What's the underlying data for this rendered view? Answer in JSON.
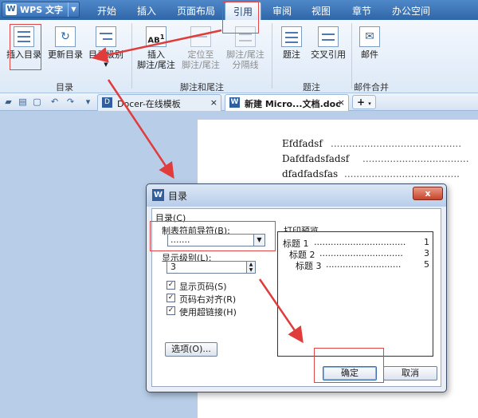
{
  "app": {
    "name": "WPS 文字",
    "logo_letter": "W"
  },
  "menu": [
    "开始",
    "插入",
    "页面布局",
    "引用",
    "审阅",
    "视图",
    "章节",
    "办公空间"
  ],
  "menu_active": "引用",
  "ribbon": {
    "insert_toc": "插入目录",
    "update_toc": "更新目录",
    "toc_level": "目录级别",
    "toc_group": "目录",
    "insert_footnote_1": "插入",
    "insert_footnote_2": "脚注/尾注",
    "goto_footnote_1": "定位至",
    "goto_footnote_2": "脚注/尾注",
    "footnote_sep_1": "脚注/尾注",
    "footnote_sep_2": "分隔线",
    "footnote_group": "脚注和尾注",
    "caption": "题注",
    "cross_ref": "交叉引用",
    "caption_group": "题注",
    "mail": "邮件",
    "mail_group": "邮件合并"
  },
  "tabs": {
    "docer": "Docer-在线模板",
    "doc": "新建 Micro...文档.doc *",
    "close": "×",
    "add": "+"
  },
  "document_lines": [
    "Efdfadsf",
    "Dafdfadsfadsf",
    "dfadfadsfas"
  ],
  "dialog": {
    "title": "目录",
    "close": "x",
    "section": "目录(C)",
    "leader_label": "制表符前导符(B):",
    "leader_value": ".......",
    "level_label": "显示级别(L):",
    "level_value": "3",
    "cb_page_numbers": "显示页码(S)",
    "cb_right_align": "页码右对齐(R)",
    "cb_hyperlinks": "使用超链接(H)",
    "options_button": "选项(O)...",
    "preview_label": "打印预览",
    "preview": [
      {
        "text": "标题 1",
        "page": "1"
      },
      {
        "text": "标题 2",
        "page": "3"
      },
      {
        "text": "标题 3",
        "page": "5"
      }
    ],
    "ok_button": "确定",
    "cancel_button": "取消"
  },
  "colors": {
    "title_bar": "#2f66a8",
    "highlight_box": "#e04848",
    "arrow": "#e03c3c"
  }
}
